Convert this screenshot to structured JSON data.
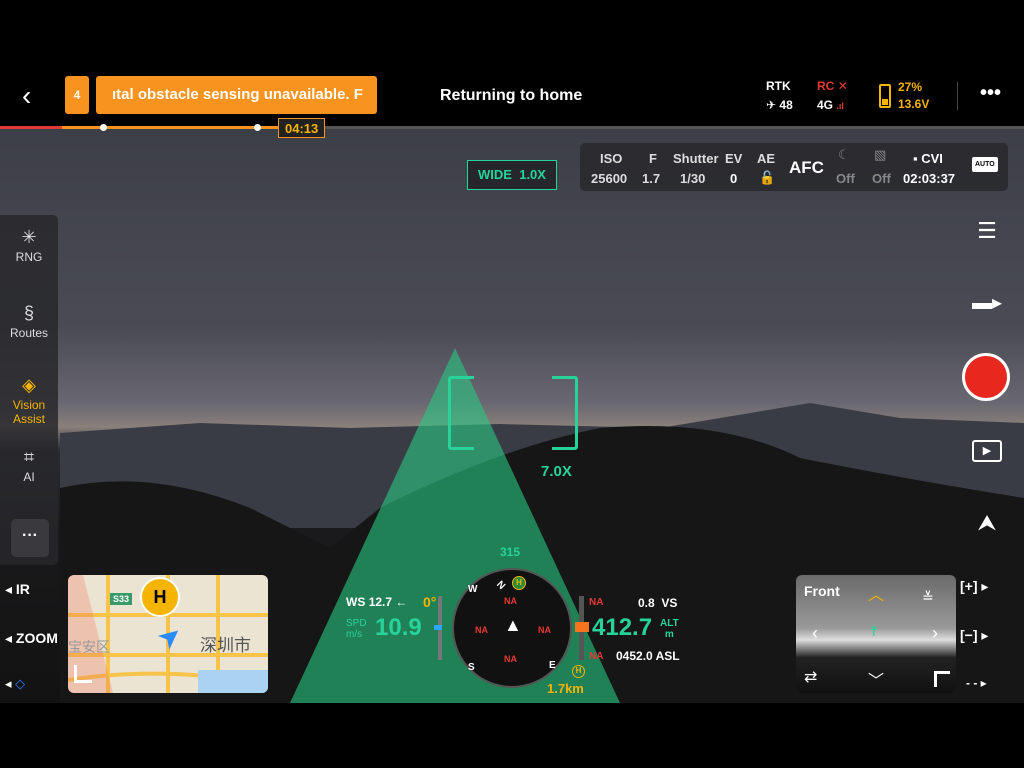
{
  "topbar": {
    "back_icon": "chevron-left-icon",
    "warning_count": "4",
    "warning_text": "ıtal obstacle sensing unavailable. F",
    "status": "Returning to home",
    "rtk_label": "RTK",
    "rtk_sats": "48",
    "rc_label": "RC",
    "rc_status_icon": "x-icon",
    "network": "4G",
    "battery_percent": "27%",
    "battery_voltage": "13.6V",
    "more_icon": "more-icon",
    "accent": "#f7931e"
  },
  "timeline": {
    "time": "04:13"
  },
  "camera": {
    "lens": "WIDE",
    "zoom": "1.0X",
    "iso_label": "ISO",
    "iso": "25600",
    "f_label": "F",
    "f": "1.7",
    "shutter_label": "Shutter",
    "shutter": "1/30",
    "ev_label": "EV",
    "ev": "0",
    "ae_label": "AE",
    "focus": "AFC",
    "night_mode": "Off",
    "mirror": "Off",
    "storage": "CVI",
    "remaining": "02:03:37",
    "auto_icon": "AUTO"
  },
  "sidebar": {
    "items": [
      {
        "label": "RNG",
        "icon": "rng-icon"
      },
      {
        "label": "Routes",
        "icon": "routes-icon"
      },
      {
        "label": "Vision Assist",
        "icon": "vision-assist-icon"
      },
      {
        "label": "AI",
        "icon": "ai-icon"
      }
    ]
  },
  "target": {
    "zoom": "7.0X"
  },
  "left_controls": {
    "ir": "IR",
    "zoom": "ZOOM"
  },
  "map": {
    "road": "S33",
    "city": "深圳市",
    "district": "宝安区",
    "home": "H"
  },
  "hud": {
    "ws_label": "WS",
    "ws": "12.7",
    "wind_arrow": "←",
    "gimbal": "0°",
    "spd_label": "SPD",
    "spd_unit": "m/s",
    "spd": "10.9",
    "heading": "315",
    "compass": [
      "N",
      "E",
      "S",
      "W"
    ],
    "na": "NA",
    "alt": "412.7",
    "alt_label": "ALT",
    "alt_unit": "m",
    "vs": "0.8",
    "vs_label": "VS",
    "asl": "0452.0",
    "asl_label": "ASL",
    "home_dist": "1.7km"
  },
  "fpv": {
    "label": "Front"
  },
  "right_controls": {
    "zoom_in": "[+]",
    "zoom_out": "[−]",
    "more": "- -"
  }
}
